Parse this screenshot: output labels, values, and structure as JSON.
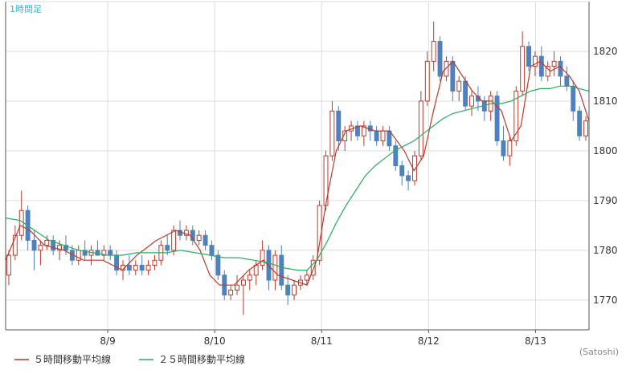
{
  "chart_data": {
    "type": "candlestick",
    "title": "",
    "period_label": "1時間足",
    "credit": "(Satoshi)",
    "xlabel": "",
    "ylabel": "",
    "grid": true,
    "legend_placement": "bottom-left",
    "ylim": [
      1764,
      1830
    ],
    "y_ticks": [
      1770,
      1780,
      1790,
      1800,
      1810,
      1820
    ],
    "x_range": [
      0,
      120
    ],
    "x_ticks": [
      {
        "label": "8/9",
        "x": 21
      },
      {
        "label": "8/10",
        "x": 43
      },
      {
        "label": "8/11",
        "x": 65
      },
      {
        "label": "8/12",
        "x": 87
      },
      {
        "label": "8/13",
        "x": 109
      }
    ],
    "colors": {
      "up": "#c0392b",
      "down": "#4f81bd",
      "ma5": "#c0392b",
      "ma25": "#27ae60",
      "grid": "#dddddd",
      "axis": "#555555"
    },
    "series": [
      {
        "name": "５時間移動平均線",
        "type": "line",
        "color": "#c0392b",
        "values": [
          [
            0,
            1778
          ],
          [
            3,
            1785
          ],
          [
            5,
            1784
          ],
          [
            8,
            1781
          ],
          [
            12,
            1780
          ],
          [
            16,
            1778
          ],
          [
            20,
            1778
          ],
          [
            24,
            1776
          ],
          [
            27,
            1779
          ],
          [
            31,
            1782
          ],
          [
            35,
            1784
          ],
          [
            38,
            1783
          ],
          [
            40,
            1780
          ],
          [
            42,
            1775
          ],
          [
            44,
            1773
          ],
          [
            47,
            1773
          ],
          [
            50,
            1776
          ],
          [
            53,
            1778
          ],
          [
            56,
            1775
          ],
          [
            59,
            1774
          ],
          [
            62,
            1773
          ],
          [
            64,
            1778
          ],
          [
            66,
            1790
          ],
          [
            68,
            1800
          ],
          [
            70,
            1804
          ],
          [
            73,
            1805
          ],
          [
            76,
            1804
          ],
          [
            79,
            1804
          ],
          [
            82,
            1800
          ],
          [
            84,
            1796
          ],
          [
            86,
            1799
          ],
          [
            88,
            1808
          ],
          [
            90,
            1816
          ],
          [
            92,
            1818
          ],
          [
            94,
            1815
          ],
          [
            96,
            1812
          ],
          [
            98,
            1810
          ],
          [
            100,
            1810
          ],
          [
            102,
            1808
          ],
          [
            104,
            1802
          ],
          [
            106,
            1805
          ],
          [
            108,
            1817
          ],
          [
            110,
            1818
          ],
          [
            112,
            1816
          ],
          [
            114,
            1817
          ],
          [
            116,
            1815
          ],
          [
            118,
            1812
          ],
          [
            120,
            1806
          ]
        ]
      },
      {
        "name": "２５時間移動平均線",
        "type": "line",
        "color": "#27ae60",
        "values": [
          [
            0,
            1786.5
          ],
          [
            3,
            1786
          ],
          [
            6,
            1784
          ],
          [
            9,
            1782
          ],
          [
            12,
            1781
          ],
          [
            15,
            1780
          ],
          [
            18,
            1779.5
          ],
          [
            21,
            1779
          ],
          [
            24,
            1779
          ],
          [
            27,
            1779.5
          ],
          [
            30,
            1779.5
          ],
          [
            33,
            1779.5
          ],
          [
            36,
            1780
          ],
          [
            39,
            1779.5
          ],
          [
            42,
            1779
          ],
          [
            45,
            1778.5
          ],
          [
            48,
            1778.5
          ],
          [
            51,
            1778
          ],
          [
            54,
            1777.5
          ],
          [
            57,
            1776.5
          ],
          [
            60,
            1776
          ],
          [
            62,
            1776
          ],
          [
            64,
            1778
          ],
          [
            66,
            1781.5
          ],
          [
            68,
            1785.5
          ],
          [
            70,
            1789
          ],
          [
            72,
            1792
          ],
          [
            74,
            1795
          ],
          [
            76,
            1797
          ],
          [
            78,
            1798.5
          ],
          [
            80,
            1800
          ],
          [
            82,
            1801
          ],
          [
            84,
            1802
          ],
          [
            86,
            1803.5
          ],
          [
            88,
            1805
          ],
          [
            90,
            1806.5
          ],
          [
            92,
            1807.5
          ],
          [
            94,
            1808
          ],
          [
            96,
            1808.5
          ],
          [
            98,
            1809
          ],
          [
            100,
            1809.5
          ],
          [
            102,
            1809.5
          ],
          [
            104,
            1810
          ],
          [
            106,
            1811
          ],
          [
            108,
            1812
          ],
          [
            110,
            1812.5
          ],
          [
            112,
            1812.5
          ],
          [
            114,
            1813
          ],
          [
            116,
            1813
          ],
          [
            118,
            1812.5
          ],
          [
            120,
            1812
          ]
        ]
      }
    ],
    "candles": [
      [
        1775,
        1780,
        1773,
        1779
      ],
      [
        1779,
        1785,
        1778,
        1783
      ],
      [
        1783,
        1792,
        1782,
        1788
      ],
      [
        1788,
        1789,
        1780,
        1782
      ],
      [
        1782,
        1784,
        1776,
        1780
      ],
      [
        1780,
        1782,
        1777,
        1781
      ],
      [
        1781,
        1783,
        1780,
        1782
      ],
      [
        1782,
        1783,
        1779,
        1780
      ],
      [
        1780,
        1782,
        1778,
        1781
      ],
      [
        1781,
        1783,
        1779,
        1780
      ],
      [
        1780,
        1781,
        1777,
        1778
      ],
      [
        1778,
        1781,
        1777,
        1780
      ],
      [
        1780,
        1782,
        1778,
        1779
      ],
      [
        1779,
        1781,
        1777,
        1780
      ],
      [
        1780,
        1782,
        1779,
        1779
      ],
      [
        1779,
        1781,
        1778,
        1780
      ],
      [
        1780,
        1781,
        1778,
        1779
      ],
      [
        1779,
        1780,
        1775,
        1776
      ],
      [
        1776,
        1778,
        1774,
        1777
      ],
      [
        1777,
        1779,
        1775,
        1776
      ],
      [
        1776,
        1778,
        1775,
        1777
      ],
      [
        1777,
        1779,
        1775,
        1776
      ],
      [
        1776,
        1778,
        1775,
        1777
      ],
      [
        1777,
        1779,
        1776,
        1778
      ],
      [
        1778,
        1782,
        1777,
        1781
      ],
      [
        1781,
        1783,
        1779,
        1780
      ],
      [
        1780,
        1785,
        1779,
        1784
      ],
      [
        1784,
        1786,
        1782,
        1783
      ],
      [
        1783,
        1785,
        1782,
        1784
      ],
      [
        1784,
        1785,
        1781,
        1782
      ],
      [
        1782,
        1784,
        1781,
        1783
      ],
      [
        1783,
        1784,
        1780,
        1781
      ],
      [
        1781,
        1782,
        1778,
        1779
      ],
      [
        1779,
        1780,
        1774,
        1775
      ],
      [
        1775,
        1776,
        1770,
        1771
      ],
      [
        1771,
        1773,
        1770,
        1772
      ],
      [
        1772,
        1775,
        1771,
        1773
      ],
      [
        1773,
        1775,
        1767,
        1774
      ],
      [
        1774,
        1776,
        1772,
        1775
      ],
      [
        1775,
        1778,
        1773,
        1777
      ],
      [
        1777,
        1782,
        1776,
        1780
      ],
      [
        1780,
        1781,
        1772,
        1774
      ],
      [
        1774,
        1780,
        1772,
        1779
      ],
      [
        1779,
        1781,
        1772,
        1773
      ],
      [
        1773,
        1775,
        1769,
        1771
      ],
      [
        1771,
        1774,
        1770,
        1773
      ],
      [
        1773,
        1775,
        1772,
        1774
      ],
      [
        1774,
        1776,
        1773,
        1775
      ],
      [
        1775,
        1779,
        1774,
        1778
      ],
      [
        1778,
        1790,
        1777,
        1789
      ],
      [
        1789,
        1800,
        1788,
        1799
      ],
      [
        1799,
        1810,
        1798,
        1808
      ],
      [
        1808,
        1809,
        1800,
        1802
      ],
      [
        1802,
        1805,
        1800,
        1804
      ],
      [
        1804,
        1806,
        1802,
        1805
      ],
      [
        1805,
        1806,
        1802,
        1803
      ],
      [
        1803,
        1806,
        1801,
        1805
      ],
      [
        1805,
        1806,
        1802,
        1804
      ],
      [
        1804,
        1805,
        1801,
        1802
      ],
      [
        1802,
        1805,
        1801,
        1804
      ],
      [
        1804,
        1805,
        1800,
        1801
      ],
      [
        1801,
        1802,
        1796,
        1797
      ],
      [
        1797,
        1798,
        1793,
        1795
      ],
      [
        1795,
        1796,
        1792,
        1794
      ],
      [
        1794,
        1800,
        1793,
        1799
      ],
      [
        1799,
        1812,
        1798,
        1810
      ],
      [
        1810,
        1820,
        1809,
        1818
      ],
      [
        1818,
        1826,
        1816,
        1822
      ],
      [
        1822,
        1823,
        1814,
        1815
      ],
      [
        1815,
        1819,
        1814,
        1818
      ],
      [
        1818,
        1819,
        1810,
        1812
      ],
      [
        1812,
        1815,
        1810,
        1814
      ],
      [
        1814,
        1815,
        1808,
        1809
      ],
      [
        1809,
        1812,
        1807,
        1811
      ],
      [
        1811,
        1813,
        1808,
        1810
      ],
      [
        1810,
        1811,
        1806,
        1808
      ],
      [
        1808,
        1812,
        1806,
        1811
      ],
      [
        1811,
        1812,
        1801,
        1802
      ],
      [
        1802,
        1805,
        1798,
        1799
      ],
      [
        1799,
        1803,
        1797,
        1802
      ],
      [
        1802,
        1813,
        1801,
        1812
      ],
      [
        1812,
        1824,
        1811,
        1821
      ],
      [
        1821,
        1822,
        1816,
        1817
      ],
      [
        1817,
        1820,
        1815,
        1819
      ],
      [
        1819,
        1821,
        1814,
        1815
      ],
      [
        1815,
        1818,
        1814,
        1817
      ],
      [
        1817,
        1820,
        1815,
        1818
      ],
      [
        1818,
        1819,
        1813,
        1815
      ],
      [
        1815,
        1817,
        1812,
        1813
      ],
      [
        1813,
        1814,
        1806,
        1808
      ],
      [
        1808,
        1809,
        1802,
        1803
      ],
      [
        1803,
        1807,
        1802,
        1806
      ]
    ]
  },
  "legend": {
    "ma5_label": "５時間移動平均線",
    "ma25_label": "２５時間移動平均線"
  }
}
